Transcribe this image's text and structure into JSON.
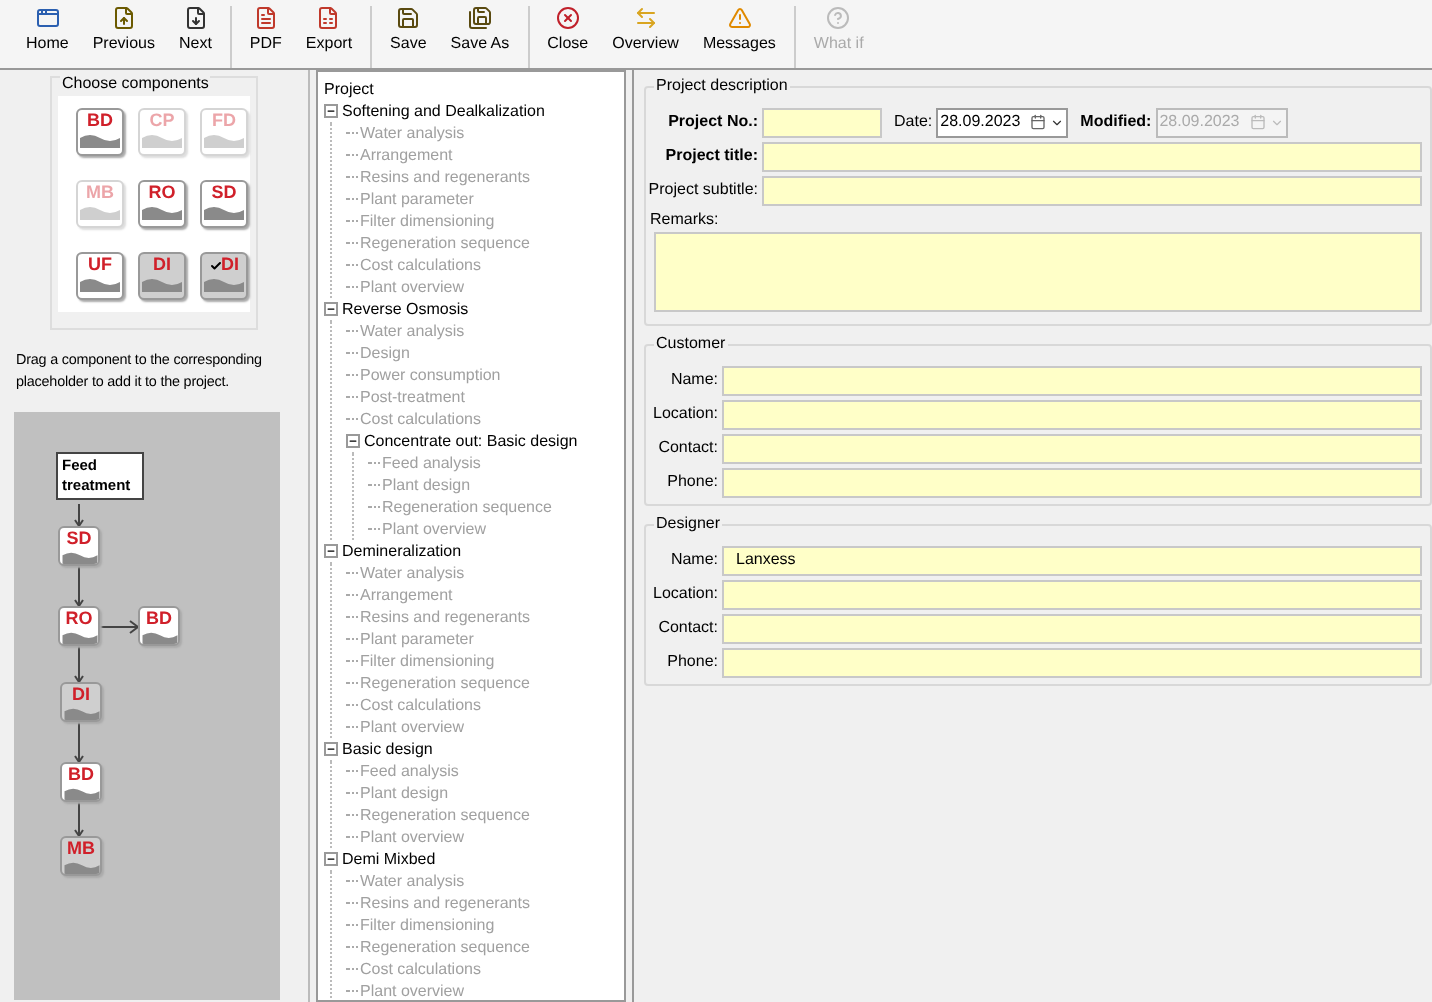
{
  "toolbar": [
    [
      {
        "label": "Home",
        "disabled": false
      },
      {
        "label": "Previous",
        "disabled": false
      },
      {
        "label": "Next",
        "disabled": false
      }
    ],
    [
      {
        "label": "PDF",
        "disabled": false
      },
      {
        "label": "Export",
        "disabled": false
      }
    ],
    [
      {
        "label": "Save",
        "disabled": false
      },
      {
        "label": "Save As",
        "disabled": false
      }
    ],
    [
      {
        "label": "Close",
        "disabled": false
      },
      {
        "label": "Overview",
        "disabled": false
      },
      {
        "label": "Messages",
        "disabled": false
      }
    ],
    [
      {
        "label": "What if",
        "disabled": true
      }
    ]
  ],
  "components": {
    "title": "Choose components",
    "tiles": [
      {
        "label": "BD",
        "enabled": true,
        "checked": false
      },
      {
        "label": "CP",
        "enabled": false,
        "checked": false
      },
      {
        "label": "FD",
        "enabled": false,
        "checked": false
      },
      {
        "label": "MB",
        "enabled": false,
        "checked": false
      },
      {
        "label": "RO",
        "enabled": true,
        "checked": false
      },
      {
        "label": "SD",
        "enabled": true,
        "checked": false
      },
      {
        "label": "UF",
        "enabled": true,
        "checked": false
      },
      {
        "label": "DI",
        "enabled": true,
        "checked": false
      },
      {
        "label": "DI",
        "enabled": true,
        "checked": true
      }
    ],
    "hint": "Drag a component to the corresponding placeholder to add it to the project."
  },
  "diagram": {
    "feed": "Feed treatment",
    "nodes": [
      {
        "label": "SD"
      },
      {
        "label": "RO"
      },
      {
        "label": "BD"
      },
      {
        "label": "DI"
      },
      {
        "label": "BD"
      },
      {
        "label": "MB"
      }
    ]
  },
  "tree": {
    "root": "Project",
    "children": [
      {
        "label": "Softening and Dealkalization",
        "children": [
          {
            "label": "Water analysis"
          },
          {
            "label": "Arrangement"
          },
          {
            "label": "Resins and regenerants"
          },
          {
            "label": "Plant parameter"
          },
          {
            "label": "Filter dimensioning"
          },
          {
            "label": "Regeneration sequence"
          },
          {
            "label": "Cost calculations"
          },
          {
            "label": "Plant overview"
          }
        ]
      },
      {
        "label": "Reverse Osmosis",
        "children": [
          {
            "label": "Water analysis"
          },
          {
            "label": "Design"
          },
          {
            "label": "Power consumption"
          },
          {
            "label": "Post-treatment"
          },
          {
            "label": "Cost calculations"
          },
          {
            "label": "Concentrate out: Basic design",
            "children": [
              {
                "label": "Feed analysis"
              },
              {
                "label": "Plant design"
              },
              {
                "label": "Regeneration sequence"
              },
              {
                "label": "Plant overview"
              }
            ]
          }
        ]
      },
      {
        "label": "Demineralization",
        "children": [
          {
            "label": "Water analysis"
          },
          {
            "label": "Arrangement"
          },
          {
            "label": "Resins and regenerants"
          },
          {
            "label": "Plant parameter"
          },
          {
            "label": "Filter dimensioning"
          },
          {
            "label": "Regeneration sequence"
          },
          {
            "label": "Cost calculations"
          },
          {
            "label": "Plant overview"
          }
        ]
      },
      {
        "label": "Basic design",
        "children": [
          {
            "label": "Feed analysis"
          },
          {
            "label": "Plant design"
          },
          {
            "label": "Regeneration sequence"
          },
          {
            "label": "Plant overview"
          }
        ]
      },
      {
        "label": "Demi Mixbed",
        "children": [
          {
            "label": "Water analysis"
          },
          {
            "label": "Resins and regenerants"
          },
          {
            "label": "Filter dimensioning"
          },
          {
            "label": "Regeneration sequence"
          },
          {
            "label": "Cost calculations"
          },
          {
            "label": "Plant overview"
          }
        ]
      }
    ]
  },
  "project": {
    "title": "Project description",
    "number_label": "Project No.:",
    "date_label": "Date:",
    "date": "28.09.2023",
    "modified_label": "Modified:",
    "modified": "28.09.2023",
    "title_label": "Project title:",
    "subtitle_label": "Project subtitle:",
    "remarks_label": "Remarks:"
  },
  "customer": {
    "title": "Customer",
    "fields": [
      {
        "label": "Name:"
      },
      {
        "label": "Location:"
      },
      {
        "label": "Contact:"
      },
      {
        "label": "Phone:"
      }
    ]
  },
  "designer": {
    "title": "Designer",
    "fields": [
      {
        "label": "Name:",
        "value": "Lanxess"
      },
      {
        "label": "Location:"
      },
      {
        "label": "Contact:"
      },
      {
        "label": "Phone:"
      }
    ]
  }
}
